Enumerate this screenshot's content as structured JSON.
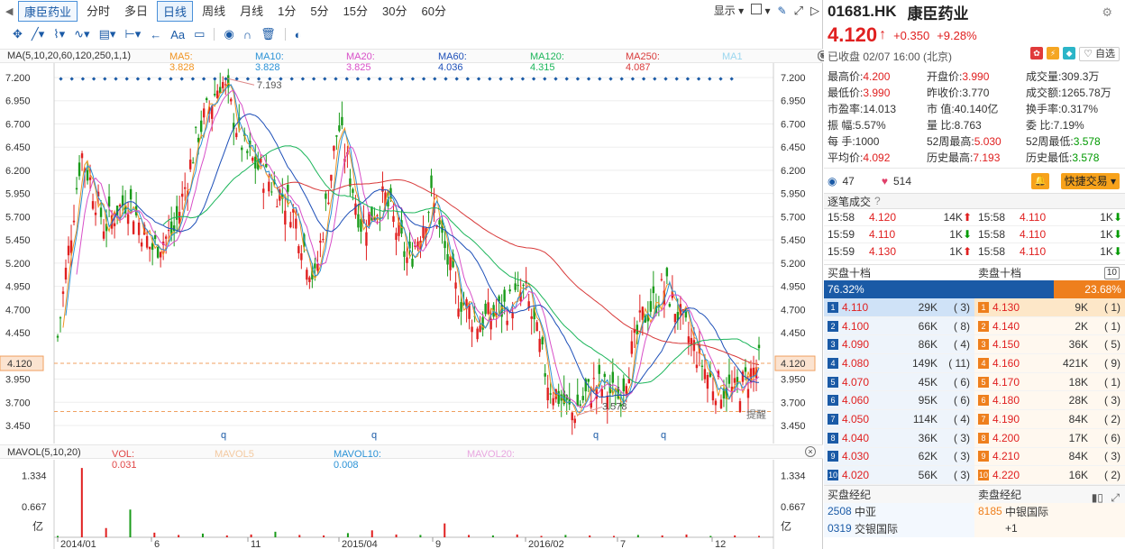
{
  "period_bar": {
    "stock_tab": "康臣药业",
    "tabs": [
      "分时",
      "多日",
      "日线",
      "周线",
      "月线",
      "1分",
      "5分",
      "15分",
      "30分",
      "60分"
    ],
    "active": "日线",
    "display_label": "显示"
  },
  "toolbar": {
    "text_tool": "Aa"
  },
  "ma_legend": {
    "title": "MA(5,10,20,60,120,250,1,1)",
    "items": [
      {
        "label": "MA5: 3.828",
        "color": "#f09320"
      },
      {
        "label": "MA10: 3.828",
        "color": "#2a92d6"
      },
      {
        "label": "MA20: 3.825",
        "color": "#d84fc8"
      },
      {
        "label": "MA60: 4.036",
        "color": "#1d4fb8"
      },
      {
        "label": "MA120: 4.315",
        "color": "#1bb55a"
      },
      {
        "label": "MA250: 4.087",
        "color": "#d83a3a"
      },
      {
        "label": "MA1",
        "color": "#9ad6ef"
      }
    ]
  },
  "vol_legend": {
    "title": "MAVOL(5,10,20)",
    "items": [
      {
        "label": "VOL: 0.031",
        "color": "#e04545"
      },
      {
        "label": "MAVOL5",
        "color": "#f3c9a0"
      },
      {
        "label": "MAVOL10: 0.008",
        "color": "#2a92d6"
      },
      {
        "label": "MAVOL20:",
        "color": "#e8a7e0"
      }
    ]
  },
  "chart_data": [
    {
      "type": "candlestick",
      "title": "",
      "y_ticks": [
        "7.200",
        "6.950",
        "6.700",
        "6.450",
        "6.200",
        "5.950",
        "5.700",
        "5.450",
        "5.200",
        "4.950",
        "4.700",
        "4.450",
        "3.950",
        "3.700",
        "3.450"
      ],
      "ylim": [
        3.45,
        7.2
      ],
      "x_ticks": [
        "2014/01",
        "6",
        "11",
        "2015/04",
        "9",
        "2016/02",
        "7",
        "12"
      ],
      "current_price_label": "4.120",
      "annotations": [
        "7.193",
        "3.578",
        "提醒"
      ],
      "marker_label": "q",
      "series": [
        {
          "name": "MA5",
          "color": "#f09320"
        },
        {
          "name": "MA10",
          "color": "#2a92d6"
        },
        {
          "name": "MA20",
          "color": "#d84fc8"
        },
        {
          "name": "MA60",
          "color": "#1d4fb8"
        },
        {
          "name": "MA120",
          "color": "#1bb55a"
        },
        {
          "name": "MA250",
          "color": "#d83a3a"
        }
      ],
      "close_path": [
        {
          "x": "2014/01",
          "y": 4.4
        },
        {
          "x": "2014/02",
          "y": 6.4
        },
        {
          "x": "2014/03",
          "y": 5.6
        },
        {
          "x": "2014/04",
          "y": 5.9
        },
        {
          "x": "2014/05",
          "y": 5.35
        },
        {
          "x": "2014/07",
          "y": 5.55
        },
        {
          "x": "2014/09",
          "y": 6.6
        },
        {
          "x": "2014/10",
          "y": 7.19
        },
        {
          "x": "2014/11",
          "y": 6.4
        },
        {
          "x": "2014/12",
          "y": 6.1
        },
        {
          "x": "2015/01",
          "y": 5.8
        },
        {
          "x": "2015/03",
          "y": 5.0
        },
        {
          "x": "2015/04",
          "y": 6.7
        },
        {
          "x": "2015/05",
          "y": 5.6
        },
        {
          "x": "2015/06",
          "y": 5.9
        },
        {
          "x": "2015/07",
          "y": 5.2
        },
        {
          "x": "2015/08",
          "y": 5.9
        },
        {
          "x": "2015/09",
          "y": 4.9
        },
        {
          "x": "2015/10",
          "y": 4.55
        },
        {
          "x": "2015/11",
          "y": 4.7
        },
        {
          "x": "2015/12",
          "y": 4.9
        },
        {
          "x": "2016/01",
          "y": 3.9
        },
        {
          "x": "2016/02",
          "y": 3.58
        },
        {
          "x": "2016/04",
          "y": 3.9
        },
        {
          "x": "2016/06",
          "y": 3.75
        },
        {
          "x": "2016/07",
          "y": 4.6
        },
        {
          "x": "2016/08",
          "y": 4.95
        },
        {
          "x": "2016/10",
          "y": 4.4
        },
        {
          "x": "2016/11",
          "y": 3.9
        },
        {
          "x": "2016/12",
          "y": 3.8
        },
        {
          "x": "2017/02",
          "y": 4.12
        }
      ]
    },
    {
      "type": "bar",
      "title": "",
      "y_ticks": [
        "1.334",
        "0.667"
      ],
      "y_unit": "亿",
      "ylim": [
        0,
        1.6
      ],
      "values": [
        0.03,
        1.5,
        0.2,
        0.6,
        0.1,
        0.05,
        0.08,
        0.04,
        0.06,
        0.12,
        0.05,
        0.04,
        0.09,
        0.15,
        0.06,
        0.05,
        0.3,
        0.05,
        0.04,
        0.06,
        0.03,
        0.05,
        0.04,
        0.03,
        0.05,
        0.04,
        0.06,
        0.03,
        0.04,
        0.03
      ]
    }
  ],
  "quote": {
    "code": "01681.HK",
    "name": "康臣药业",
    "price": "4.120",
    "change": "+0.350",
    "change_pct": "+9.28%",
    "status": "已收盘 02/07 16:00 (北京)",
    "watch_label": "自选"
  },
  "stats": [
    [
      {
        "l": "最高价:",
        "v": "4.200",
        "c": "red"
      },
      {
        "l": "开盘价:",
        "v": "3.990",
        "c": "red"
      },
      {
        "l": "成交量:",
        "v": "309.3万",
        "c": ""
      }
    ],
    [
      {
        "l": "最低价:",
        "v": "3.990",
        "c": "red"
      },
      {
        "l": "昨收价:",
        "v": "3.770",
        "c": ""
      },
      {
        "l": "成交额:",
        "v": "1265.78万",
        "c": ""
      }
    ],
    [
      {
        "l": "市盈率:",
        "v": "14.013",
        "c": ""
      },
      {
        "l": "市  值:",
        "v": "40.140亿",
        "c": ""
      },
      {
        "l": "换手率:",
        "v": "0.317%",
        "c": ""
      }
    ],
    [
      {
        "l": "振  幅:",
        "v": "5.57%",
        "c": ""
      },
      {
        "l": "量  比:",
        "v": "8.763",
        "c": ""
      },
      {
        "l": "委  比:",
        "v": "7.19%",
        "c": ""
      }
    ],
    [
      {
        "l": "每  手:",
        "v": "1000",
        "c": ""
      },
      {
        "l": "52周最高:",
        "v": "5.030",
        "c": "red"
      },
      {
        "l": "52周最低:",
        "v": "3.578",
        "c": "grn"
      }
    ],
    [
      {
        "l": "平均价:",
        "v": "4.092",
        "c": "red"
      },
      {
        "l": "历史最高:",
        "v": "7.193",
        "c": "red"
      },
      {
        "l": "历史最低:",
        "v": "3.578",
        "c": "grn"
      }
    ]
  ],
  "social": {
    "views": "47",
    "likes": "514",
    "quick_trade": "快捷交易"
  },
  "ticks_title": "逐笔成交",
  "ticks": [
    [
      {
        "t": "15:58",
        "p": "4.120",
        "v": "14K",
        "dir": "up"
      },
      {
        "t": "15:58",
        "p": "4.110",
        "v": "1K",
        "dir": "down"
      }
    ],
    [
      {
        "t": "15:59",
        "p": "4.110",
        "v": "1K",
        "dir": "down"
      },
      {
        "t": "15:58",
        "p": "4.110",
        "v": "1K",
        "dir": "down"
      }
    ],
    [
      {
        "t": "15:59",
        "p": "4.130",
        "v": "1K",
        "dir": "up"
      },
      {
        "t": "15:58",
        "p": "4.110",
        "v": "1K",
        "dir": "down"
      }
    ]
  ],
  "orderbook": {
    "bid_title": "买盘十档",
    "ask_title": "卖盘十档",
    "depth_badge": "10",
    "bid_pct": "76.32%",
    "ask_pct": "23.68%",
    "bid_ratio": 0.7632,
    "rows": [
      {
        "bp": "4.110",
        "bv": "29K",
        "bc": "3",
        "ap": "4.130",
        "av": "9K",
        "ac": "1"
      },
      {
        "bp": "4.100",
        "bv": "66K",
        "bc": "8",
        "ap": "4.140",
        "av": "2K",
        "ac": "1"
      },
      {
        "bp": "4.090",
        "bv": "86K",
        "bc": "4",
        "ap": "4.150",
        "av": "36K",
        "ac": "5"
      },
      {
        "bp": "4.080",
        "bv": "149K",
        "bc": "11",
        "ap": "4.160",
        "av": "421K",
        "ac": "9"
      },
      {
        "bp": "4.070",
        "bv": "45K",
        "bc": "6",
        "ap": "4.170",
        "av": "18K",
        "ac": "1"
      },
      {
        "bp": "4.060",
        "bv": "95K",
        "bc": "6",
        "ap": "4.180",
        "av": "28K",
        "ac": "3"
      },
      {
        "bp": "4.050",
        "bv": "114K",
        "bc": "4",
        "ap": "4.190",
        "av": "84K",
        "ac": "2"
      },
      {
        "bp": "4.040",
        "bv": "36K",
        "bc": "3",
        "ap": "4.200",
        "av": "17K",
        "ac": "6"
      },
      {
        "bp": "4.030",
        "bv": "62K",
        "bc": "3",
        "ap": "4.210",
        "av": "84K",
        "ac": "3"
      },
      {
        "bp": "4.020",
        "bv": "56K",
        "bc": "3",
        "ap": "4.220",
        "av": "16K",
        "ac": "2"
      }
    ]
  },
  "brokers": {
    "buy_title": "买盘经纪",
    "sell_title": "卖盘经纪",
    "buy": [
      {
        "id": "2508",
        "name": "中亚"
      },
      {
        "id": "0319",
        "name": "交银国际"
      }
    ],
    "sell": [
      {
        "id": "8185",
        "name": "中银国际"
      },
      {
        "id": "",
        "name": "+1"
      }
    ]
  }
}
